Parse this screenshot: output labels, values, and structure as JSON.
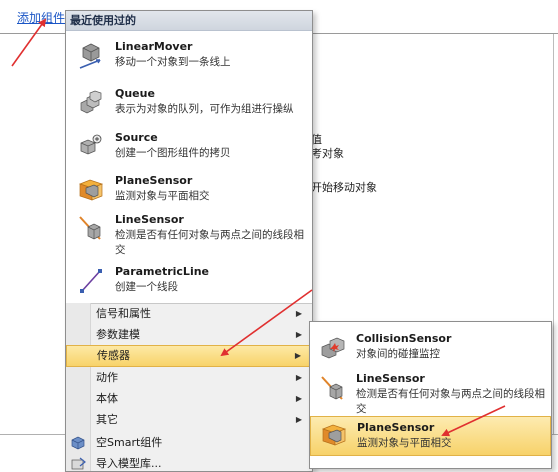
{
  "page": {
    "add_component_link": "添加组件",
    "bg_text": [
      "值",
      "考对象",
      "开始移动对象"
    ]
  },
  "menu": {
    "header": "最近使用过的",
    "recent": [
      {
        "name": "LinearMover",
        "desc": "移动一个对象到一条线上",
        "icon": "linear-mover-icon"
      },
      {
        "name": "Queue",
        "desc": "表示为对象的队列，可作为组进行操纵",
        "icon": "queue-icon"
      },
      {
        "name": "Source",
        "desc": "创建一个图形组件的拷贝",
        "icon": "source-icon"
      },
      {
        "name": "PlaneSensor",
        "desc": "监测对象与平面相交",
        "icon": "plane-sensor-icon"
      },
      {
        "name": "LineSensor",
        "desc": "检测是否有任何对象与两点之间的线段相交",
        "icon": "line-sensor-icon"
      },
      {
        "name": "ParametricLine",
        "desc": "创建一个线段",
        "icon": "parametric-line-icon"
      }
    ],
    "items": [
      {
        "label": "信号和属性",
        "submenu": true
      },
      {
        "label": "参数建模",
        "submenu": true
      },
      {
        "label": "传感器",
        "submenu": true
      },
      {
        "label": "动作",
        "submenu": true
      },
      {
        "label": "本体",
        "submenu": true
      },
      {
        "label": "其它",
        "submenu": true
      },
      {
        "label": "空Smart组件",
        "submenu": false,
        "icon": "smart-component-icon"
      },
      {
        "label": "导入模型库...",
        "submenu": false,
        "icon": "import-library-icon"
      }
    ],
    "highlighted_item": "传感器"
  },
  "submenu": {
    "items": [
      {
        "name": "CollisionSensor",
        "desc": "对象间的碰撞监控",
        "icon": "collision-sensor-icon"
      },
      {
        "name": "LineSensor",
        "desc": "检测是否有任何对象与两点之间的线段相交",
        "icon": "line-sensor-icon"
      },
      {
        "name": "PlaneSensor",
        "desc": "监测对象与平面相交",
        "icon": "plane-sensor-icon"
      }
    ],
    "highlighted_item": "PlaneSensor"
  },
  "colors": {
    "annotation_arrow": "#e03030",
    "highlight": "#f8d36a",
    "link": "#1a55c5"
  }
}
